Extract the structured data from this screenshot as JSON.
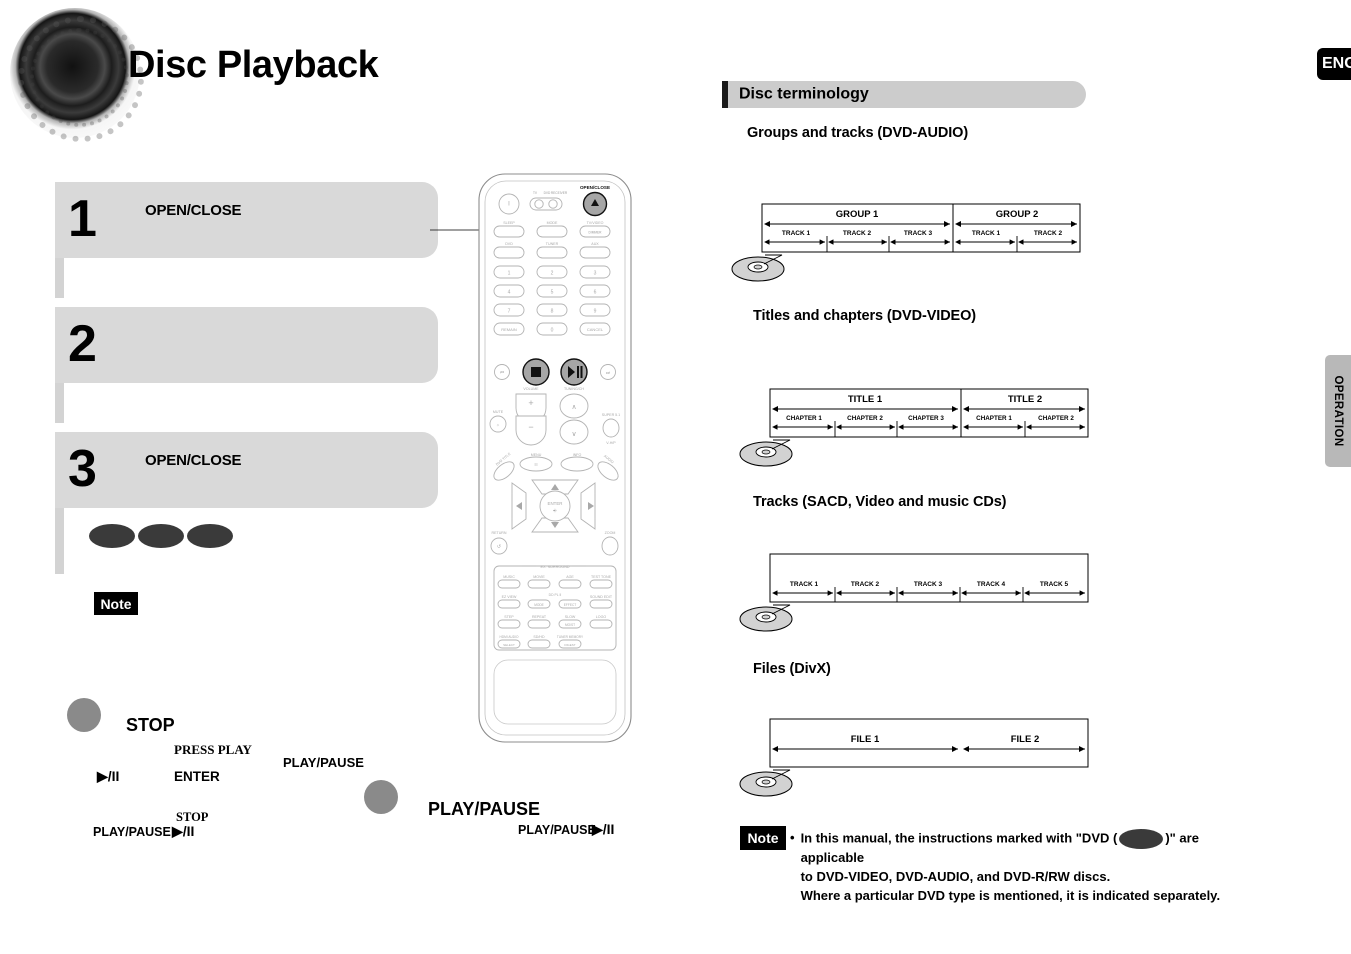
{
  "page": {
    "title": "Disc Playback",
    "language_tab": "ENG",
    "section_tab": "OPERATION"
  },
  "steps": [
    {
      "number": "1",
      "label": "OPEN/CLOSE"
    },
    {
      "number": "2",
      "label": ""
    },
    {
      "number": "3",
      "label": "OPEN/CLOSE"
    }
  ],
  "left_notes": {
    "note_label": "Note"
  },
  "left_controls": {
    "stop_label": "STOP",
    "press_play_label": "PRESS PLAY",
    "enter_label": "ENTER",
    "play_pause_label": "PLAY/PAUSE",
    "play_pause_glyph": "▶/II",
    "play_pause_small_1": "PLAY/PAUSE",
    "play_pause_big": "PLAY/PAUSE",
    "play_pause_small_2": "PLAY/PAUSE",
    "stop_small": "STOP"
  },
  "remote": {
    "labels": {
      "power": "",
      "tv_dvd_receiver": "TV DVD RECEIVER",
      "open_close": "OPEN/CLOSE",
      "sleep": "SLEEP",
      "mode": "MODE",
      "tv_video": "TV/VIDEO",
      "dimmer": "DIMMER",
      "dvd": "DVD",
      "tuner": "TUNER",
      "aux": "AUX",
      "remain": "REMAIN",
      "cancel": "CANCEL",
      "volume": "VOLUME",
      "tuning_ch": "TUNING/CH",
      "mute": "MUTE",
      "super_51": "SUPER 5.1",
      "vhf": "V-H/P",
      "menu": "MENU",
      "info": "INFO",
      "dvd_title": "DVD TITLE",
      "audio": "AUDIO",
      "enter": "ENTER",
      "return": "RETURN",
      "zoom": "ZOOM",
      "ex_surround": "EX. SURROUND",
      "music": "MUSIC",
      "movie": "MOVIE",
      "age": "AGE",
      "test_tone": "TEST TONE",
      "ez_view": "EZ VIEW",
      "dd_pl2": "DD PL II",
      "mode2": "MODE",
      "effect": "EFFECT",
      "sound_edit": "SOUND EDIT",
      "step": "STEP",
      "repeat": "REPEAT",
      "slow": "SLOW",
      "logo": "LOGO",
      "mo_st": "MO/ST",
      "hdmi_audio": "HDMI AUDIO",
      "select": "SELECT",
      "sd_hd": "SD/HD",
      "tuner_memory": "TUNER MEMORY",
      "digest": "DIGEST"
    },
    "keypad": [
      "1",
      "2",
      "3",
      "4",
      "5",
      "6",
      "7",
      "8",
      "9",
      "0"
    ],
    "highlighted": [
      "open-close",
      "stop",
      "play-pause"
    ]
  },
  "terminology": {
    "heading": "Disc terminology",
    "sections": [
      {
        "id": "groups-tracks",
        "heading": "Groups and tracks (DVD-AUDIO)",
        "top_segments": [
          {
            "label": "GROUP 1",
            "span": 3
          },
          {
            "label": "GROUP 2",
            "span": 2
          }
        ],
        "bottom_segments": [
          "TRACK 1",
          "TRACK 2",
          "TRACK 3",
          "TRACK 1",
          "TRACK 2"
        ]
      },
      {
        "id": "titles-chapters",
        "heading": "Titles and chapters (DVD-VIDEO)",
        "top_segments": [
          {
            "label": "TITLE 1",
            "span": 3
          },
          {
            "label": "TITLE 2",
            "span": 2
          }
        ],
        "bottom_segments": [
          "CHAPTER 1",
          "CHAPTER 2",
          "CHAPTER 3",
          "CHAPTER 1",
          "CHAPTER 2"
        ]
      },
      {
        "id": "tracks",
        "heading": "Tracks (SACD, Video and music CDs)",
        "top_segments": [],
        "bottom_segments": [
          "TRACK 1",
          "TRACK 2",
          "TRACK 3",
          "TRACK 4",
          "TRACK 5"
        ]
      },
      {
        "id": "files-divx",
        "heading": "Files (DivX)",
        "top_segments": [],
        "bottom_segments": [
          "FILE 1",
          "FILE 2"
        ],
        "single_row": true
      }
    ]
  },
  "bottom_note": {
    "label": "Note",
    "bullet": "•",
    "line1_before": "In this manual, the instructions marked with \"DVD (",
    "line1_after": ")\" are applicable",
    "line2": "to DVD-VIDEO, DVD-AUDIO, and DVD-R/RW discs.",
    "line3": "Where a particular DVD type is mentioned, it is indicated separately."
  },
  "colors": {
    "step_bg": "#d9d9d9",
    "term_bar": "#cccccc",
    "tab_gray": "#b8b8b8",
    "pill_dark": "#3a3a3a",
    "circle_gray": "#8a8a8a"
  }
}
